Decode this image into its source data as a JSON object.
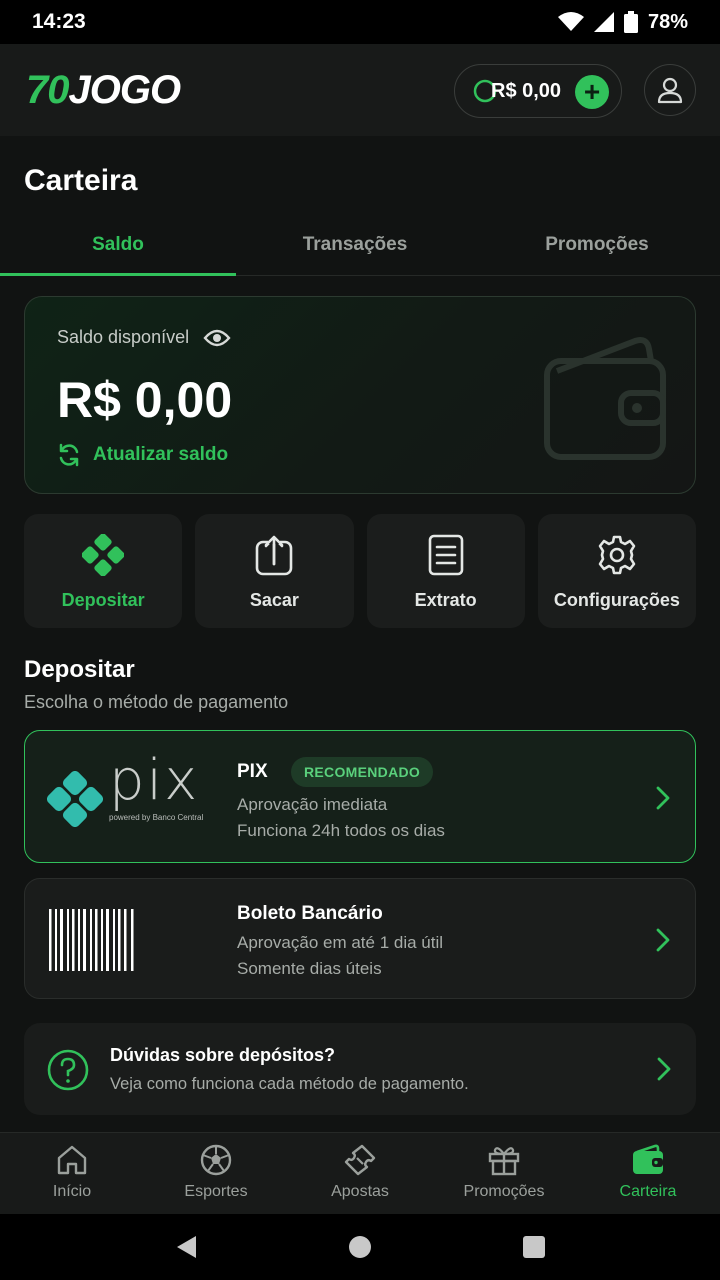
{
  "status_bar": {
    "time": "14:23",
    "battery": "78%"
  },
  "header": {
    "logo_part1": "70",
    "logo_part2": "JOGO",
    "balance": "R$ 0,00",
    "add_label": "+"
  },
  "page_title": "Carteira",
  "tabs": [
    {
      "label": "Saldo",
      "active": true
    },
    {
      "label": "Transações",
      "active": false
    },
    {
      "label": "Promoções",
      "active": false
    }
  ],
  "wallet": {
    "available_label": "Saldo disponível",
    "amount": "R$ 0,00",
    "refresh_label": "Atualizar saldo"
  },
  "actions": [
    {
      "label": "Depositar",
      "icon": "pix-icon"
    },
    {
      "label": "Sacar",
      "icon": "upload-icon"
    },
    {
      "label": "Extrato",
      "icon": "document-icon"
    },
    {
      "label": "Configurações",
      "icon": "gear-icon"
    }
  ],
  "deposit": {
    "title": "Depositar",
    "subtitle": "Escolha o método de pagamento",
    "methods": [
      {
        "name": "PIX",
        "badge": "RECOMENDADO",
        "line1": "Aprovação imediata",
        "line2": "Funciona 24h todos os dias",
        "logo_text": "pix",
        "logo_sub": "powered by Banco Central"
      },
      {
        "name": "Boleto Bancário",
        "line1": "Aprovação em até 1 dia útil",
        "line2": "Somente dias úteis"
      }
    ]
  },
  "help": {
    "title": "Dúvidas sobre depósitos?",
    "subtitle": "Veja como funciona cada método de pagamento."
  },
  "bottom_nav": [
    {
      "label": "Início",
      "icon": "home-icon"
    },
    {
      "label": "Esportes",
      "icon": "soccer-ball-icon"
    },
    {
      "label": "Apostas",
      "icon": "ticket-icon"
    },
    {
      "label": "Promoções",
      "icon": "gift-icon"
    },
    {
      "label": "Carteira",
      "icon": "wallet-icon",
      "active": true
    }
  ],
  "colors": {
    "accent": "#31c15b",
    "background": "#111312",
    "card": "#1b1d1c",
    "pix": "#32bcad"
  }
}
